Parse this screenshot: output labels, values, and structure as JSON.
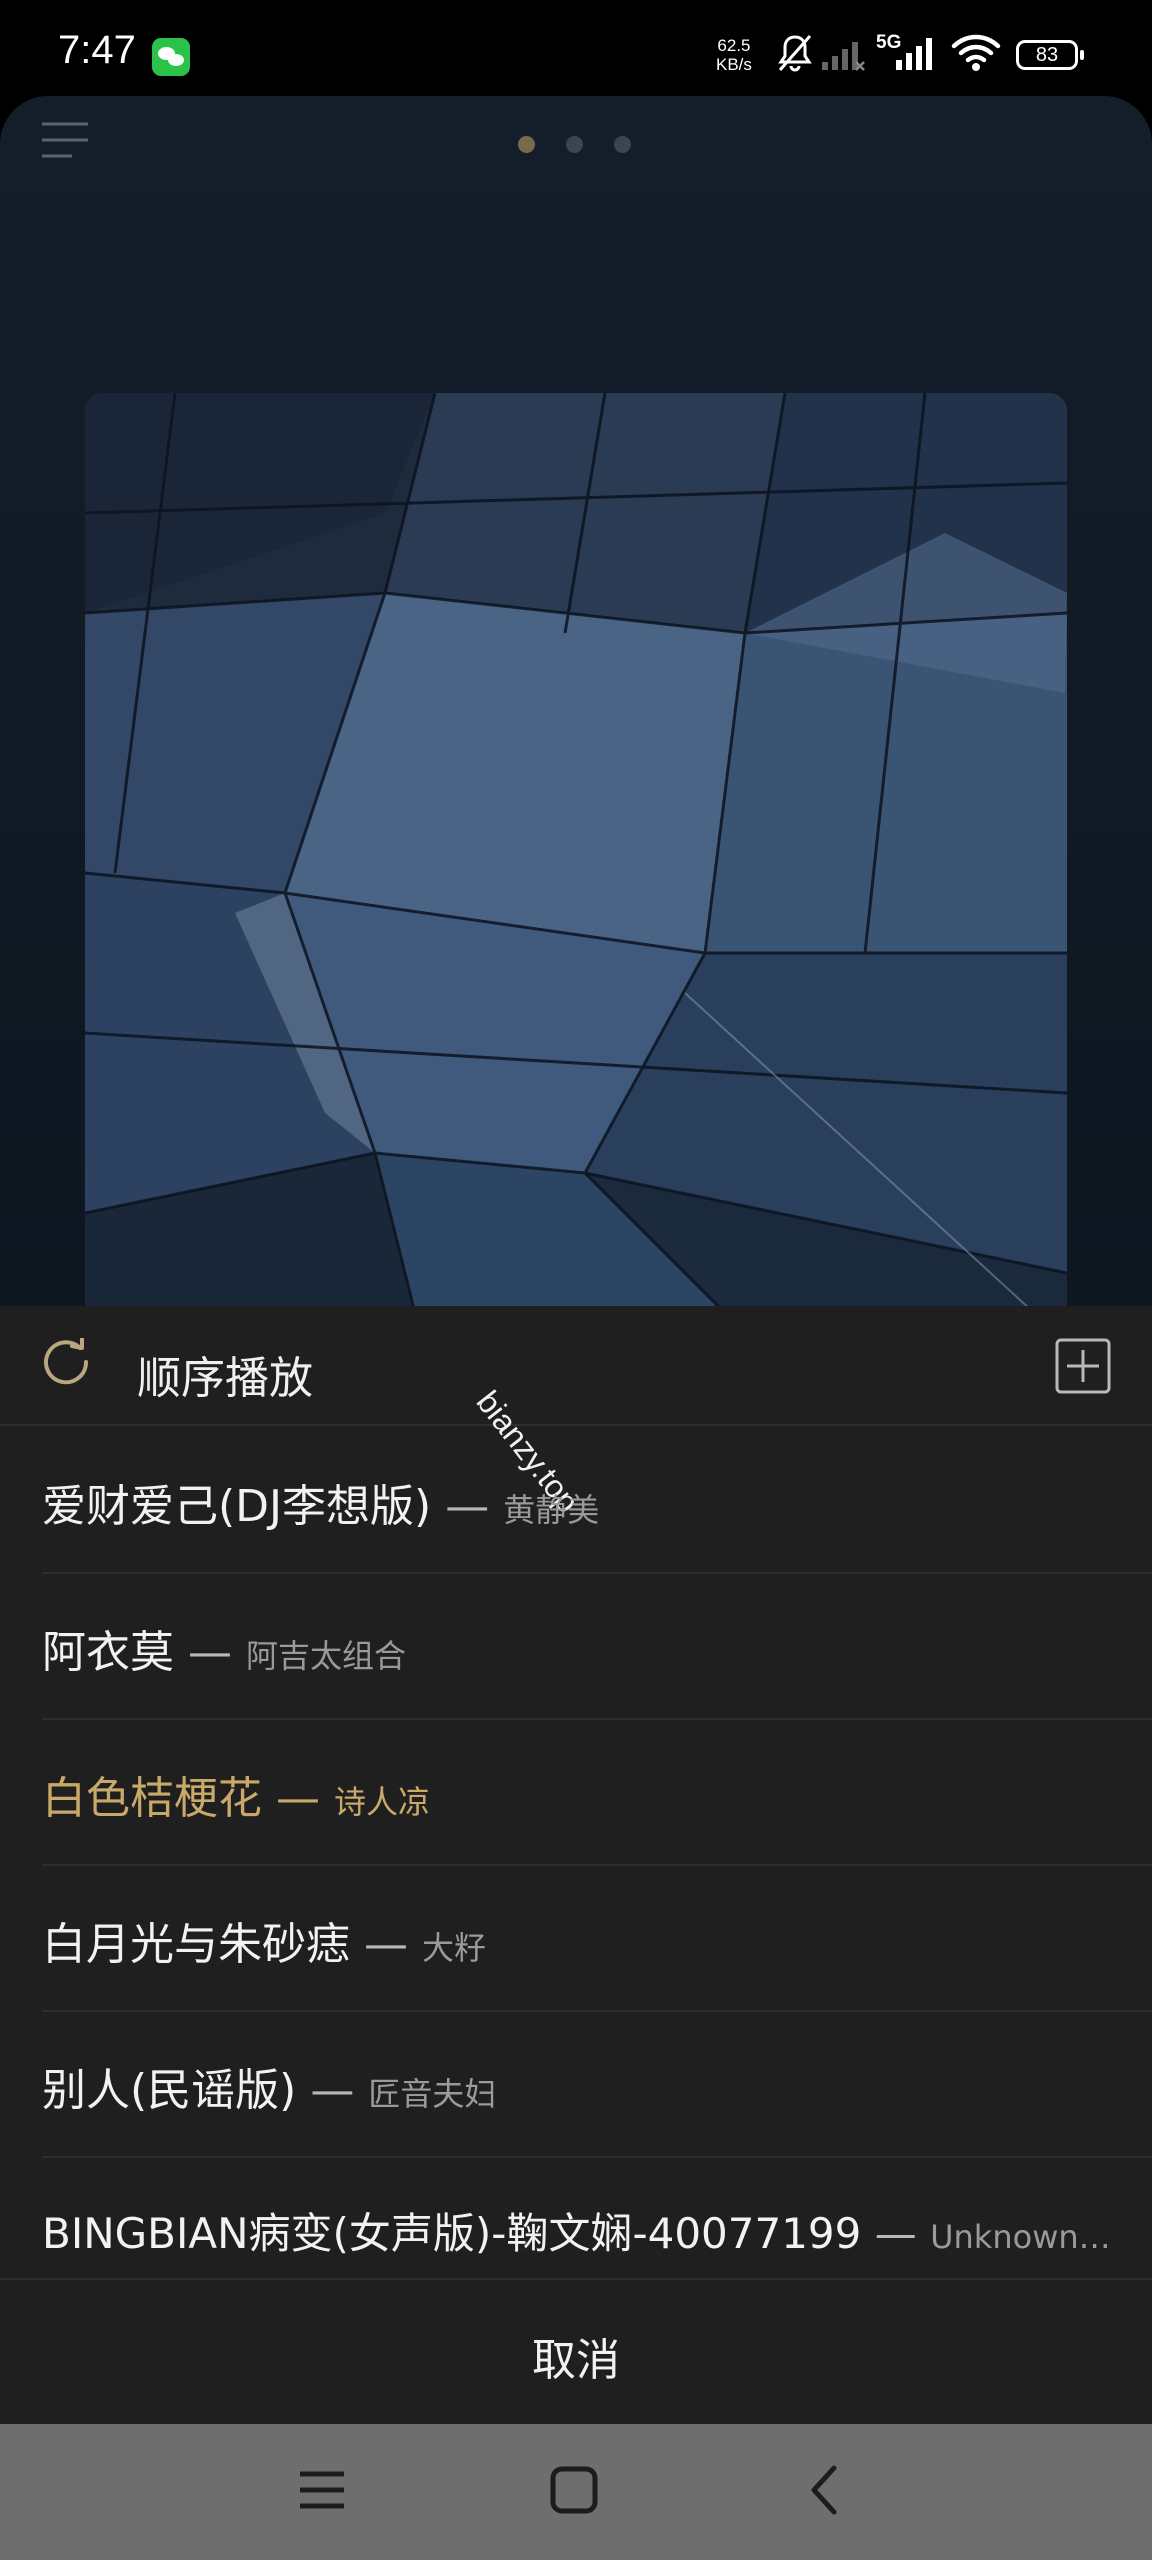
{
  "status_bar": {
    "time": "7:47",
    "net_speed_value": "62.5",
    "net_speed_unit": "KB/s",
    "network_type": "5G",
    "battery": "83"
  },
  "player": {
    "page_indicator": {
      "count": 3,
      "active_index": 0
    }
  },
  "sheet": {
    "play_mode": "顺序播放",
    "watermark": "bianzy.top",
    "separator": "—",
    "tracks": [
      {
        "title": "爱财爱己(DJ李想版)",
        "artist": "黄静美",
        "active": false
      },
      {
        "title": "阿衣莫",
        "artist": "阿吉太组合",
        "active": false
      },
      {
        "title": "白色桔梗花",
        "artist": "诗人凉",
        "active": true
      },
      {
        "title": "白月光与朱砂痣",
        "artist": "大籽",
        "active": false
      },
      {
        "title": "别人(民谣版)",
        "artist": "匠音夫妇",
        "active": false
      },
      {
        "title": "BINGBIAN病变(女声版)-鞠文娴-40077199",
        "artist": "Unknown…",
        "active": false
      }
    ],
    "cancel_label": "取消"
  },
  "colors": {
    "accent": "#c9a96a",
    "sheet_bg": "#1f1f1f",
    "nav_bg": "#6e6e6e"
  }
}
